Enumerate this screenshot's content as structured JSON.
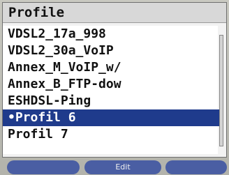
{
  "title": "Profile",
  "profiles": [
    {
      "label": "VDSL2_17a_998",
      "selected": false
    },
    {
      "label": "VDSL2_30a_VoIP",
      "selected": false
    },
    {
      "label": "Annex_M_VoIP_w/",
      "selected": false
    },
    {
      "label": "Annex_B_FTP-dow",
      "selected": false
    },
    {
      "label": "ESHDSL-Ping",
      "selected": false
    },
    {
      "label": "•Profil 6",
      "selected": true
    },
    {
      "label": "Profil 7",
      "selected": false
    }
  ],
  "softkeys": {
    "left": "",
    "middle": "Edit",
    "right": ""
  },
  "colors": {
    "selection": "#1f3b8c",
    "softkey": "#4a5ea3"
  }
}
